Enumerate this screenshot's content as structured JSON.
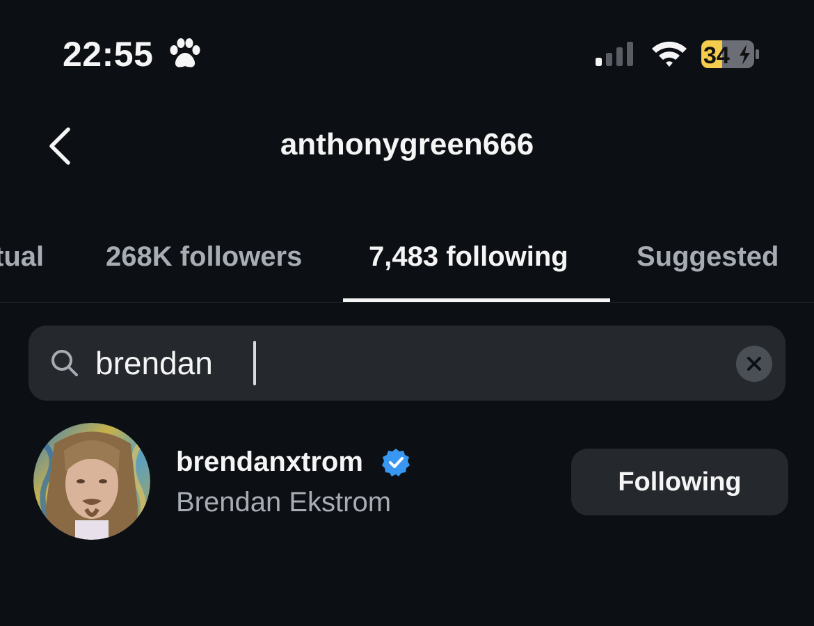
{
  "status_bar": {
    "time": "22:55",
    "status_icon": "paw-print-icon",
    "battery_percent": "34"
  },
  "header": {
    "back_icon": "chevron-left-icon",
    "title": "anthonygreen666"
  },
  "tabs": [
    {
      "label": "tual",
      "active": false
    },
    {
      "label": "268K followers",
      "active": false
    },
    {
      "label": "7,483 following",
      "active": true
    },
    {
      "label": "Suggested",
      "active": false
    }
  ],
  "search": {
    "value": "brendan",
    "icon": "search-icon",
    "clear_icon": "clear-icon"
  },
  "results": [
    {
      "username": "brendanxtrom",
      "verified": true,
      "full_name": "Brendan Ekstrom",
      "button_label": "Following"
    }
  ],
  "colors": {
    "background": "#0c1014",
    "surface": "#25292e",
    "text_primary": "#f5f5f5",
    "text_secondary": "#a8adb5",
    "verified_blue": "#3897f0",
    "battery_low": "#f5cc4c"
  }
}
